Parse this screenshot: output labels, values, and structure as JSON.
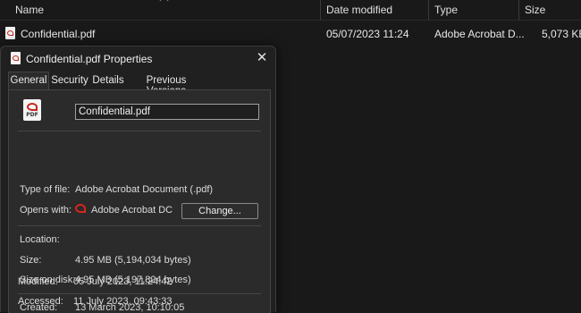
{
  "explorer": {
    "columns": {
      "name": "Name",
      "date_modified": "Date modified",
      "type": "Type",
      "size": "Size"
    },
    "rows": [
      {
        "name": "Confidential.pdf",
        "date_modified": "05/07/2023 11:24",
        "type": "Adobe Acrobat D...",
        "size": "5,073 KB",
        "icon": "pdf-file-icon"
      }
    ]
  },
  "dialog": {
    "title": "Confidential.pdf Properties",
    "tabs": [
      "General",
      "Security",
      "Details",
      "Previous Versions"
    ],
    "active_tab": "General",
    "file_icon_label": "PDF",
    "filename_value": "Confidential.pdf",
    "fields": {
      "type_label": "Type of file:",
      "type_value": "Adobe Acrobat Document (.pdf)",
      "opens_label": "Opens with:",
      "opens_value": "Adobe Acrobat DC",
      "change_button": "Change...",
      "location_label": "Location:",
      "location_value": "",
      "size_label": "Size:",
      "size_value": "4.95 MB (5,194,034 bytes)",
      "size_disk_label": "Size on disk:",
      "size_disk_value": "4.95 MB (5,197,824 bytes)",
      "created_label": "Created:",
      "created_value": "13 March 2023, 10:10:05",
      "modified_label": "Modified:",
      "modified_value": "05 July 2023, 11:24:42",
      "accessed_label": "Accessed:",
      "accessed_value": "11 July 2023, 09:43:33"
    },
    "colors": {
      "accent_acrobat": "#c4261d",
      "background": "#202020",
      "panel": "#2b2b2b"
    }
  }
}
